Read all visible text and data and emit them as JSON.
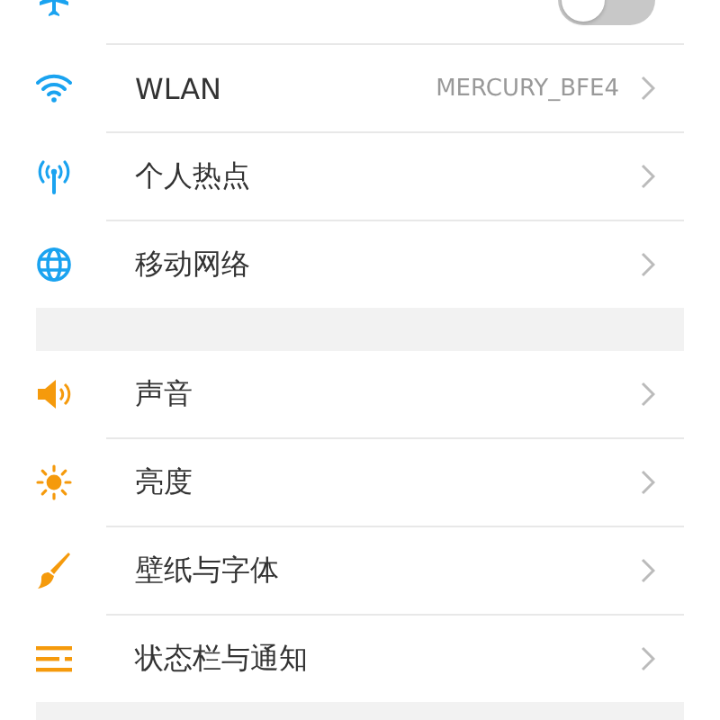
{
  "sections": [
    {
      "items": [
        {
          "kind": "toggle",
          "on": false
        },
        {
          "kind": "link",
          "label": "WLAN",
          "value": "MERCURY_BFE4"
        },
        {
          "kind": "link",
          "label": "个人热点"
        },
        {
          "kind": "link",
          "label": "移动网络"
        }
      ]
    },
    {
      "items": [
        {
          "kind": "link",
          "label": "声音"
        },
        {
          "kind": "link",
          "label": "亮度"
        },
        {
          "kind": "link",
          "label": "壁纸与字体"
        },
        {
          "kind": "link",
          "label": "状态栏与通知"
        }
      ]
    }
  ]
}
